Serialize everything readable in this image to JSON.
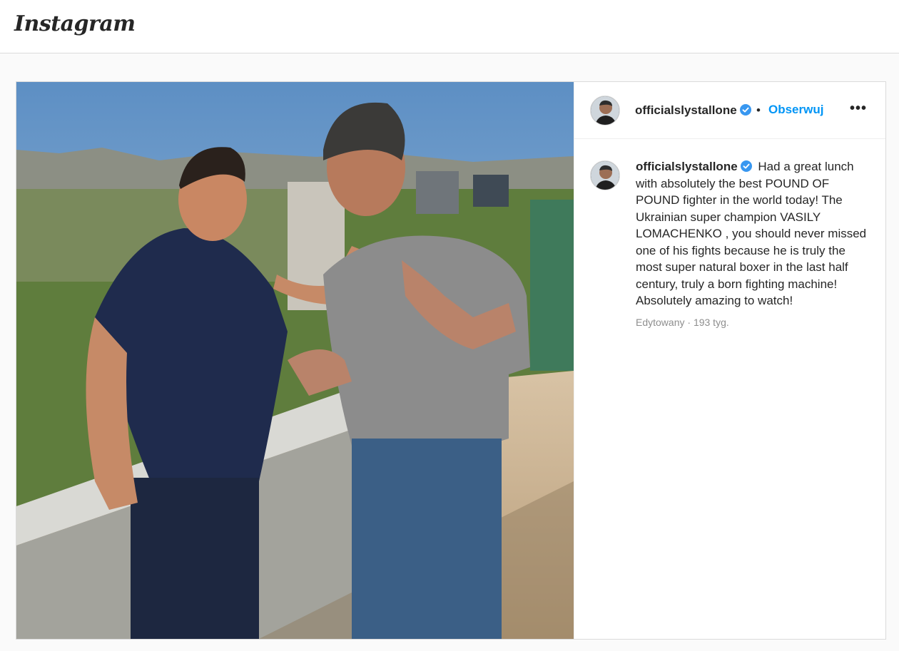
{
  "header": {
    "logo_text": "Instagram"
  },
  "post": {
    "username": "officialslystallone",
    "verified": true,
    "separator": "•",
    "follow_label": "Obserwuj",
    "more_label": "•••",
    "caption_text": "Had a great lunch with absolutely the best POUND OF POUND fighter in the world today! The Ukrainian super champion VASILY LOMACHENKO , you should never missed one of his fights because he is truly the most super natural boxer in the last half century, truly a born fighting machine! Absolutely amazing to watch!",
    "edited_label": "Edytowany",
    "time_ago": "193 tyg."
  },
  "colors": {
    "link": "#0095f6",
    "verified": "#3897f0",
    "muted": "#8e8e8e"
  }
}
